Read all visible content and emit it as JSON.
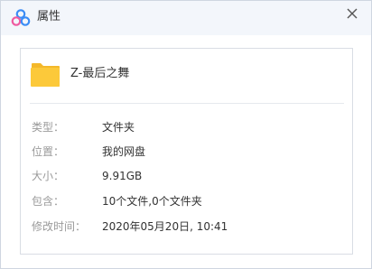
{
  "window": {
    "title": "属性",
    "logo_icon": "cloud-logo-icon",
    "close_icon": "close-icon"
  },
  "file": {
    "icon": "folder-icon",
    "icon_color": "#fcc93a",
    "name": "Z-最后之舞"
  },
  "properties": [
    {
      "label": "类型：",
      "value": "文件夹"
    },
    {
      "label": "位置：",
      "value": "我的网盘"
    },
    {
      "label": "大小：",
      "value": "9.91GB"
    },
    {
      "label": "包含：",
      "value": "10个文件,0个文件夹"
    },
    {
      "label": "修改时间：",
      "value": "2020年05月20日, 10:41"
    }
  ],
  "colors": {
    "titlebar_bg": "#f3f6fb",
    "label_text": "#9a9a9a",
    "value_text": "#333333",
    "logo_blue": "#3b8cf5",
    "logo_pink": "#ef5aa0"
  }
}
